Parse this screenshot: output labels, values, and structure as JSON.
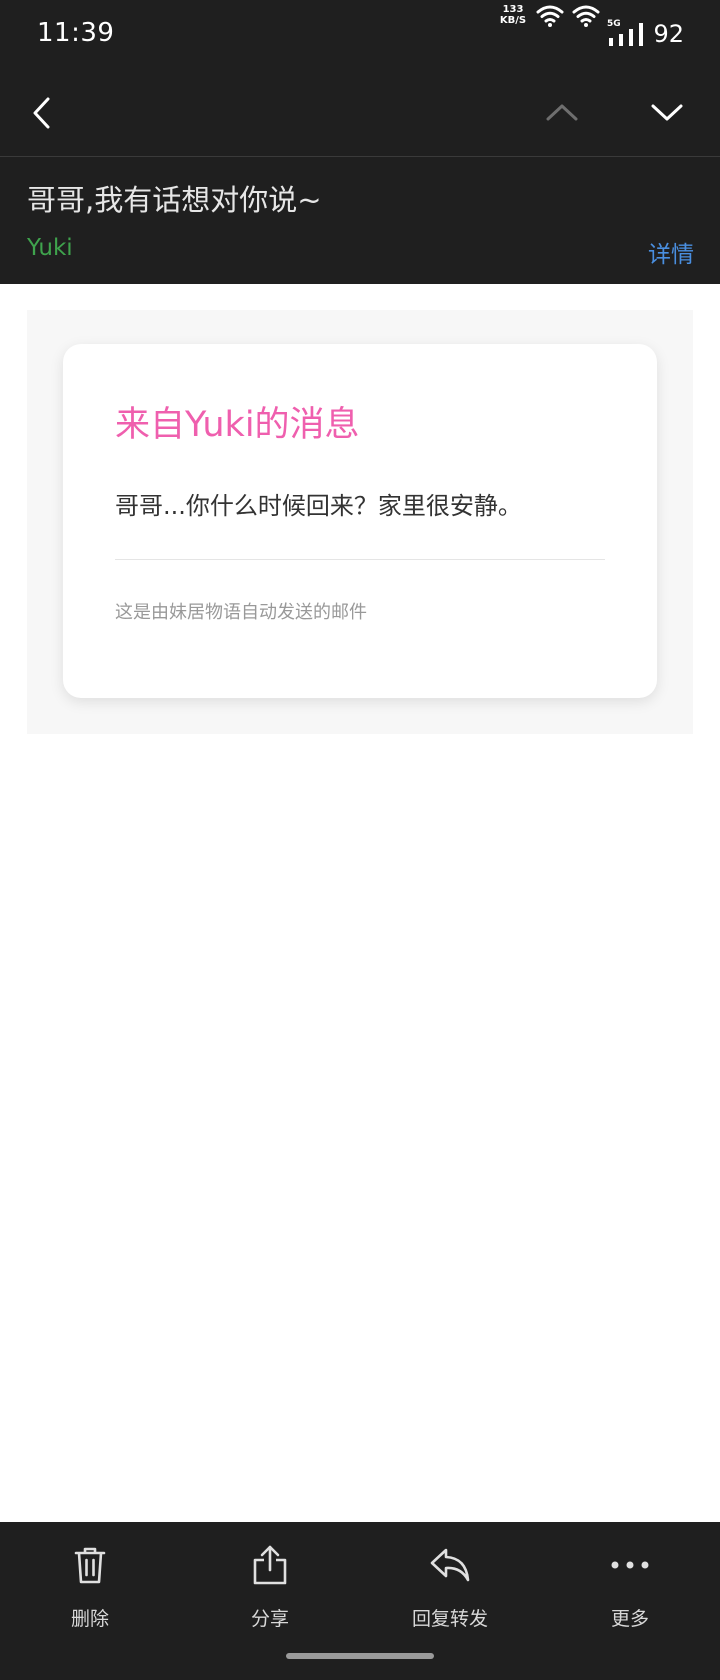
{
  "status_bar": {
    "time": "11:39",
    "net_speed_value": "133",
    "net_speed_unit": "KB/S",
    "network_type": "5G",
    "battery": "92"
  },
  "mail": {
    "subject": "哥哥,我有话想对你说~",
    "sender": "Yuki",
    "details_label": "详情"
  },
  "card": {
    "title": "来自Yuki的消息",
    "message": "哥哥...你什么时候回来？家里很安静。",
    "footer": "这是由妹居物语自动发送的邮件"
  },
  "toolbar": {
    "delete_label": "删除",
    "share_label": "分享",
    "reply_forward_label": "回复转发",
    "more_label": "更多"
  },
  "icons": {
    "back": "chevron-left-icon",
    "previous": "chevron-up-icon",
    "next": "chevron-down-icon",
    "delete": "trash-icon",
    "share": "share-icon",
    "reply": "reply-icon",
    "more": "more-dots-icon"
  },
  "colors": {
    "dark_bg": "#1f1f1f",
    "sender": "#3fa34d",
    "details_link": "#4a8fe0",
    "card_title": "#ef5fae"
  }
}
